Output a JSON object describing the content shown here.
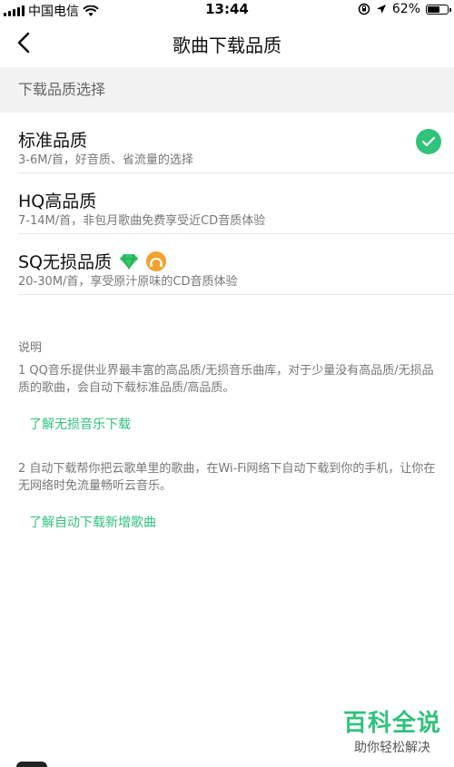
{
  "status_bar": {
    "carrier": "中国电信",
    "time": "13:44",
    "battery": "62%",
    "battery_level": 0.62
  },
  "nav": {
    "title": "歌曲下载品质"
  },
  "section": {
    "header": "下载品质选择"
  },
  "options": [
    {
      "title": "标准品质",
      "subtitle": "3-6M/首，好音质、省流量的选择",
      "selected": true
    },
    {
      "title": "HQ高品质",
      "subtitle": "7-14M/首，非包月歌曲免费享受近CD音质体验",
      "selected": false
    },
    {
      "title": "SQ无损品质",
      "subtitle": "20-30M/首，享受原汁原味的CD音质体验",
      "selected": false
    }
  ],
  "notes": {
    "title": "说明",
    "items": [
      {
        "text": "1 QQ音乐提供业界最丰富的高品质/无损音乐曲库，对于少量没有高品质/无损品质的歌曲，会自动下载标准品质/高品质。",
        "link": "了解无损音乐下载"
      },
      {
        "text": "2 自动下载帮你把云歌单里的歌曲，在Wi-Fi网络下自动下载到你的手机，让你在无网络时免流量畅听云音乐。",
        "link": "了解自动下载新增歌曲"
      }
    ]
  },
  "watermark": {
    "title": "百科全说",
    "subtitle": "助你轻松解决"
  },
  "colors": {
    "accent": "#31c27c",
    "header_bg": "#f2f2f2"
  }
}
